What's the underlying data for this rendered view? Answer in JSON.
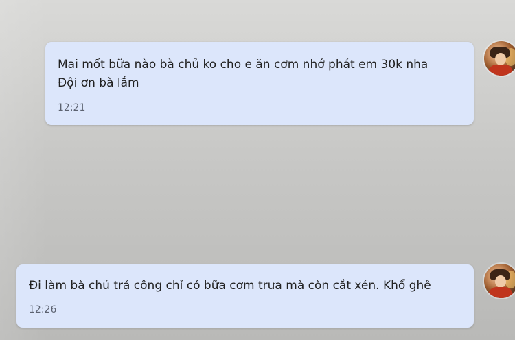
{
  "conversation": {
    "messages": [
      {
        "text": "Mai mốt bữa nào bà chủ ko cho e ăn cơm nhớ phát em 30k nha\nĐội ơn bà lắm",
        "time": "12:21"
      },
      {
        "text": "Đi làm bà chủ trả công chỉ có bữa cơm trưa mà còn cắt xén. Khổ ghê",
        "time": "12:26"
      }
    ]
  },
  "colors": {
    "message_bubble": "#dce6fb",
    "background": "#c8c8c6",
    "text": "#222222",
    "time": "#5c6270"
  },
  "icons": {
    "avatar": "user-avatar-photo"
  }
}
